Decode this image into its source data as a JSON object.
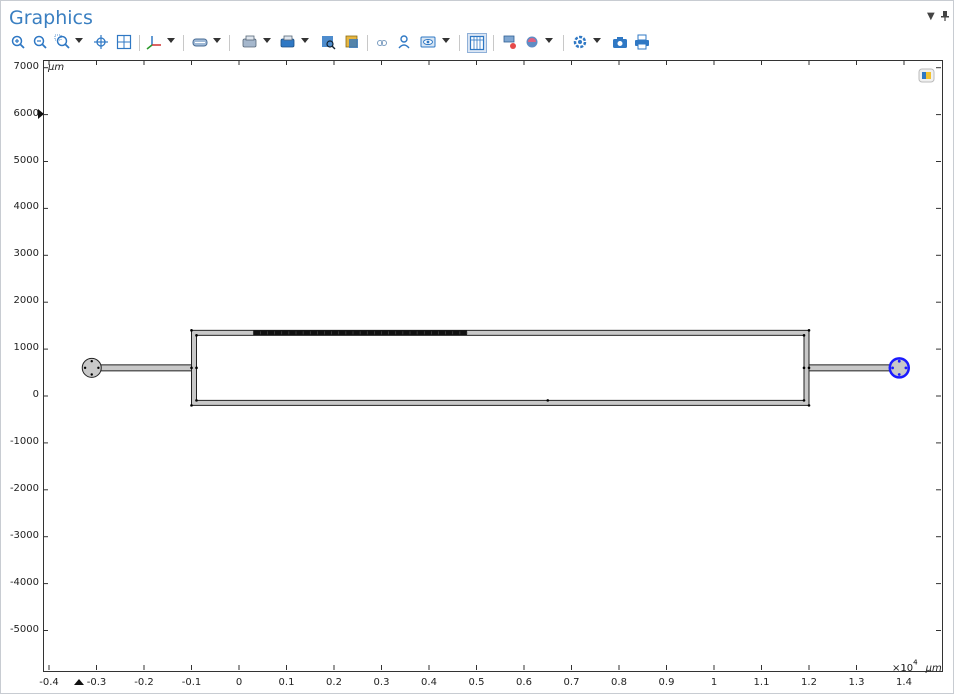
{
  "panel": {
    "title": "Graphics"
  },
  "toolbar": {
    "buttons": [
      "zoom-in-icon",
      "zoom-out-icon",
      "zoom-box-icon",
      "zoom-extents-icon",
      "zoom-selected-icon",
      "axis-orientation-icon",
      "select-mode-icon",
      "select-domains-icon",
      "select-boundaries-icon",
      "zoom-to-selection-icon",
      "highlight-icon",
      "transparency-icon",
      "hide-icon",
      "eye-icon",
      "grid-view-icon",
      "clear-selection-icon",
      "render-mode-icon",
      "scene-light-icon",
      "camera-icon",
      "print-icon"
    ]
  },
  "plot": {
    "y_unit": "µm",
    "x_unit": "µm",
    "x_multiplier": "×10",
    "x_exponent": "4",
    "y_ticks": [
      "7000",
      "6000",
      "5000",
      "4000",
      "3000",
      "2000",
      "1000",
      "0",
      "-1000",
      "-2000",
      "-3000",
      "-4000",
      "-5000"
    ],
    "x_ticks": [
      "-0.4",
      "-0.3",
      "-0.2",
      "-0.1",
      "0",
      "0.1",
      "0.2",
      "0.3",
      "0.4",
      "0.5",
      "0.6",
      "0.7",
      "0.8",
      "0.9",
      "1",
      "1.1",
      "1.2",
      "1.3",
      "1.4"
    ]
  },
  "geometry": {
    "outline_color": "#222222",
    "fill_color": "#c8c8c8",
    "selected_color": "#1a1aff",
    "chamber": {
      "x_min": -1000,
      "x_max": 12000,
      "y_min": -200,
      "y_max": 1400
    },
    "left_inlet": {
      "x_min": -3000,
      "x_max": -1000,
      "y": 600
    },
    "right_outlet": {
      "x_min": 12000,
      "x_max": 13900,
      "y": 600
    },
    "left_port": {
      "cx": -3100,
      "cy": 600,
      "r": 200
    },
    "right_port": {
      "cx": 13900,
      "cy": 600,
      "r": 200
    },
    "electrode_strip": {
      "x_min": 300,
      "x_max": 4800,
      "y": 1380
    }
  }
}
